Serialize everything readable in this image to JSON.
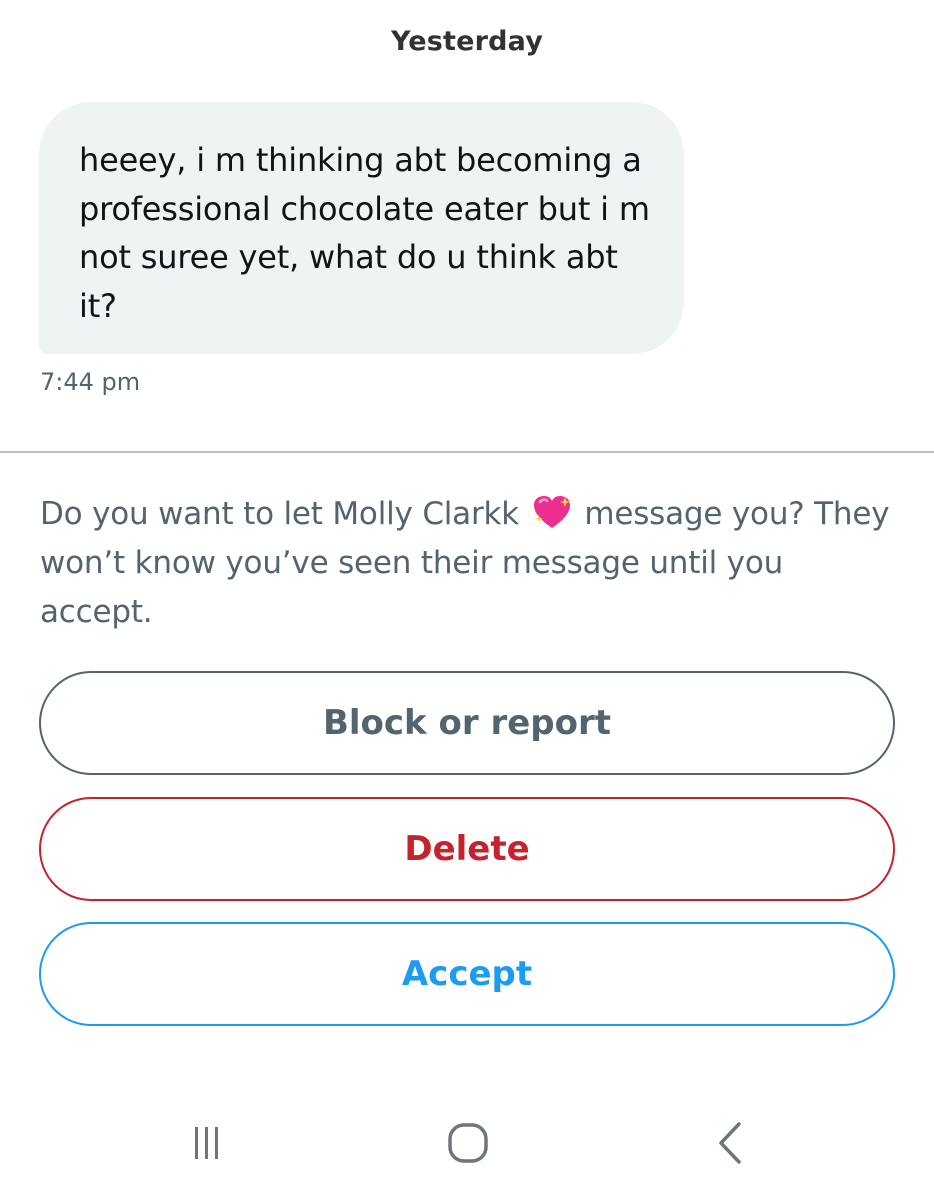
{
  "conversation": {
    "date_header": "Yesterday",
    "message": {
      "text": "heeey, i m thinking abt becoming a professional chocolate eater but i m not suree yet, what do u think abt it?",
      "time": "7:44 pm"
    }
  },
  "request": {
    "prompt_before": "Do you want to let Molly Clarkk",
    "prompt_after": "message you? They won’t know you’ve seen their message until you accept.",
    "sender_emoji_icon": "sparkling-heart-icon"
  },
  "actions": {
    "block_label": "Block or report",
    "delete_label": "Delete",
    "accept_label": "Accept"
  },
  "colors": {
    "accent_blue": "#1d9bf0",
    "danger_red": "#c4232d",
    "muted_gray": "#536471",
    "bubble_bg": "#eff3f4"
  },
  "system_nav": {
    "icons": [
      "recent-apps-icon",
      "home-icon",
      "back-icon"
    ]
  }
}
